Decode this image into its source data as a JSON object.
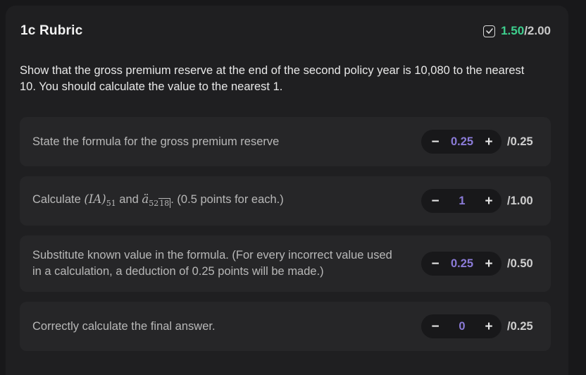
{
  "header": {
    "title": "1c Rubric",
    "score_earned": "1.50",
    "score_total": "/2.00"
  },
  "question": "Show that the gross premium reserve at the end of the second policy year is 10,080 to the nearest 10. You should calculate the value to the nearest 1.",
  "criteria": [
    {
      "text": "State the formula for the gross premium reserve",
      "value": "0.25",
      "max": "/0.25"
    },
    {
      "text_prefix": "Calculate",
      "text_mid": "and",
      "text_suffix": ". (0.5 points for each.)",
      "math_1": "(IA)",
      "math_1_sub": "51",
      "math_2": "ä",
      "math_2_sub": "52",
      "math_2_angle": "18",
      "value": "1",
      "max": "/1.00"
    },
    {
      "text": "Substitute known value in the formula. (For every incorrect value used in a calculation, a deduction of 0.25 points will be made.)",
      "value": "0.25",
      "max": "/0.50"
    },
    {
      "text": "Correctly calculate the final answer.",
      "value": "0",
      "max": "/0.25"
    }
  ],
  "controls": {
    "minus": "−",
    "plus": "+"
  },
  "colors": {
    "accent_green": "#3ecf8e",
    "accent_purple": "#8b7bd8"
  }
}
